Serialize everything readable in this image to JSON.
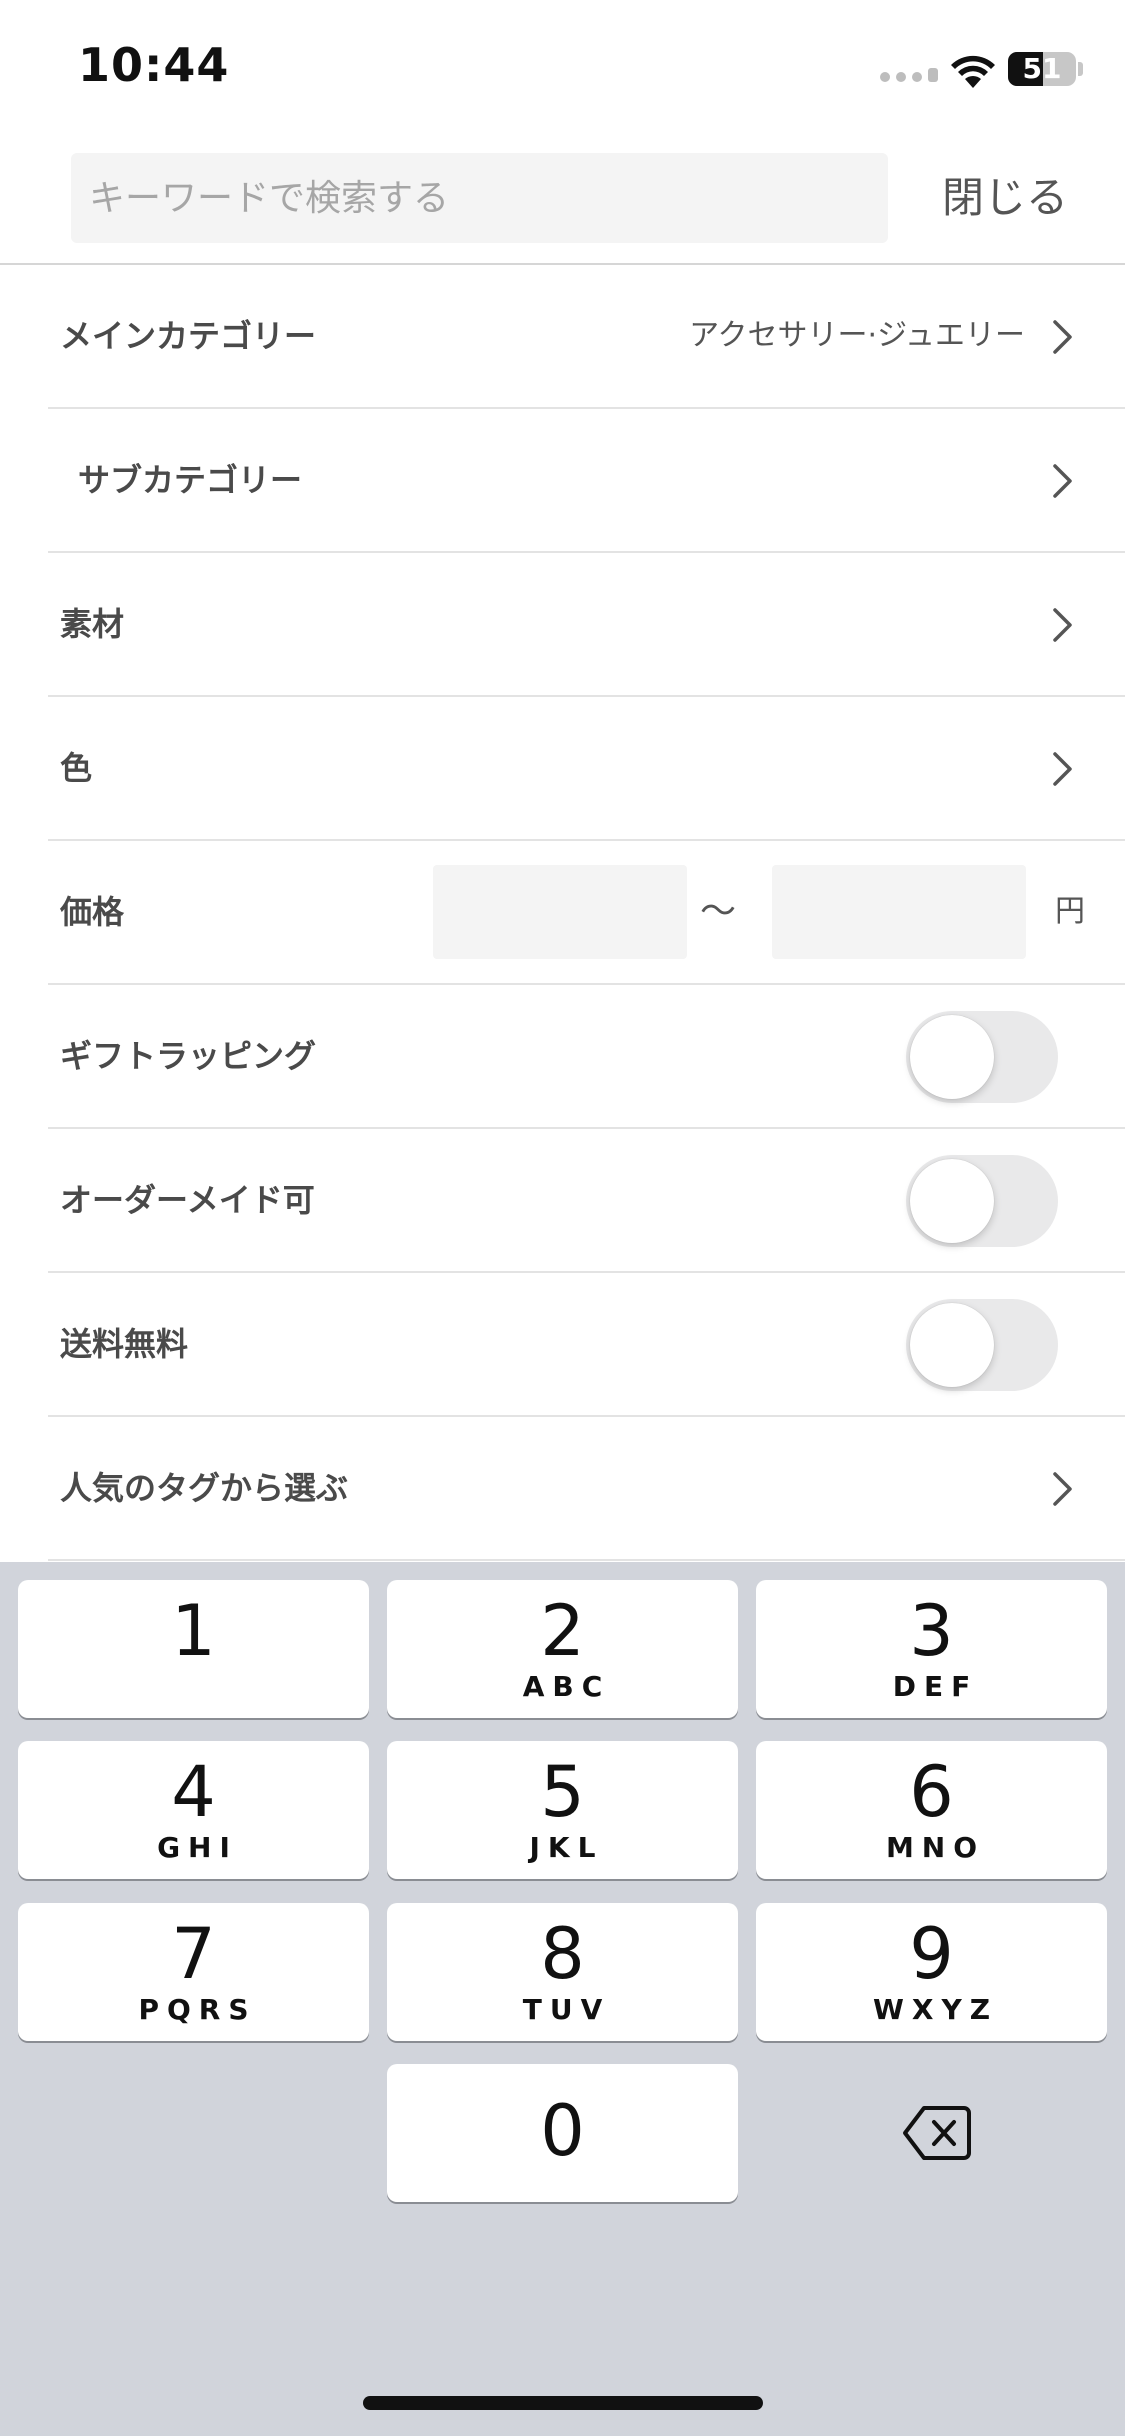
{
  "status_bar": {
    "time": "10:44",
    "battery_level": "51"
  },
  "search": {
    "placeholder": "キーワードで検索する",
    "close_label": "閉じる"
  },
  "filters": {
    "main_category": {
      "label": "メインカテゴリー",
      "value": "アクセサリー·ジュエリー"
    },
    "sub_category": {
      "label": "サブカテゴリー"
    },
    "material": {
      "label": "素材"
    },
    "color": {
      "label": "色"
    },
    "price": {
      "label": "価格",
      "separator": "〜",
      "unit": "円"
    },
    "gift_wrapping": {
      "label": "ギフトラッピング",
      "enabled": false
    },
    "made_to_order": {
      "label": "オーダーメイド可",
      "enabled": false
    },
    "free_shipping": {
      "label": "送料無料",
      "enabled": false
    },
    "popular_tags": {
      "label": "人気のタグから選ぶ"
    }
  },
  "keyboard": {
    "keys": [
      {
        "digit": "1",
        "letters": ""
      },
      {
        "digit": "2",
        "letters": "ABC"
      },
      {
        "digit": "3",
        "letters": "DEF"
      },
      {
        "digit": "4",
        "letters": "GHI"
      },
      {
        "digit": "5",
        "letters": "JKL"
      },
      {
        "digit": "6",
        "letters": "MNO"
      },
      {
        "digit": "7",
        "letters": "PQRS"
      },
      {
        "digit": "8",
        "letters": "TUV"
      },
      {
        "digit": "9",
        "letters": "WXYZ"
      },
      {
        "digit": "0",
        "letters": ""
      }
    ],
    "delete_icon": "delete-backspace-icon"
  },
  "colors": {
    "keyboard_bg": "#d1d4db",
    "input_bg": "#f4f4f4",
    "toggle_off": "#e9e9ea"
  }
}
